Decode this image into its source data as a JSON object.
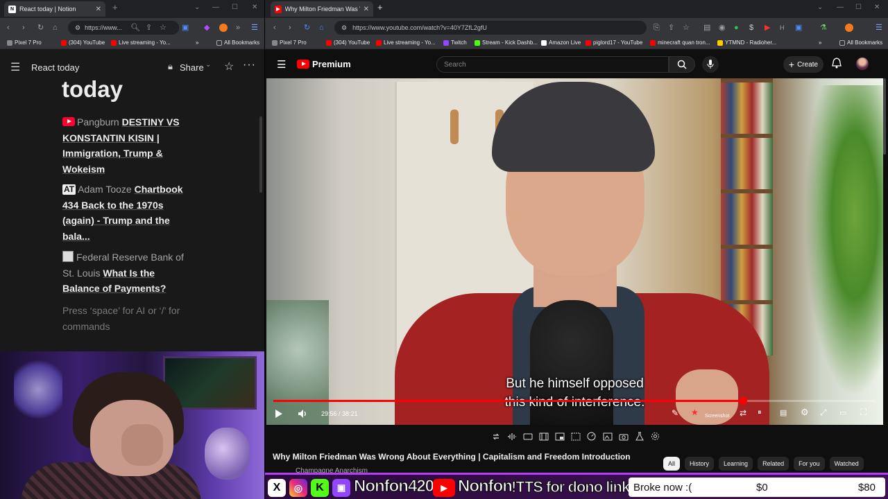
{
  "left_browser": {
    "tab_title": "React today | Notion",
    "url": "https://www...",
    "bookmarks": [
      "Pixel 7 Pro",
      "(304) YouTube",
      "Live streaming - Yo...",
      "All Bookmarks"
    ]
  },
  "notion": {
    "header_title": "React today",
    "share_label": "Share",
    "page_title": "today",
    "items": [
      {
        "source": "Pangburn",
        "link": "DESTINY VS KONSTANTIN KISIN | Immigration, Trump & Wokeism",
        "icon": "youtube-icon"
      },
      {
        "source": "Adam Tooze",
        "link": "Chartbook 434 Back to the 1970s (again) - Trump and the bala...",
        "icon": "at-icon"
      },
      {
        "source": "Federal Reserve Bank of St. Louis",
        "link": "What Is the Balance of Payments?",
        "icon": "image-icon"
      }
    ],
    "placeholder": "Press ‘space’ for AI or ‘/’ for commands"
  },
  "right_browser": {
    "tab_title": "Why Milton Friedman Was Wro",
    "url": "https://www.youtube.com/watch?v=40Y7ZfL2gfU",
    "bookmarks": [
      "Pixel 7 Pro",
      "(304) YouTube",
      "Live streaming - Yo...",
      "Twitch",
      "Stream - Kick Dashb...",
      "Amazon Live",
      "piglord17 - YouTube",
      "minecraft quan tron...",
      "YTMND - Radioher...",
      "All Bookmarks"
    ]
  },
  "youtube": {
    "logo_text": "Premium",
    "search_placeholder": "Search",
    "create_label": "Create",
    "subtitle_line1": "But he himself opposed",
    "subtitle_line2": "this kind of interference.",
    "time_display": "29:56 / 38:21",
    "progress": 0.78,
    "screenshot_label": "Screenshot",
    "video_title": "Why Milton Friedman Was Wrong About Everything | Capitalism and Freedom Introduction",
    "channel": "Champagne Anarchism",
    "chips": [
      "All",
      "History",
      "Learning",
      "Related",
      "For you",
      "Watched"
    ]
  },
  "stream_overlay": {
    "handle": "Nonfon420",
    "yt_name": "Nonfon",
    "tts_text": "!TTS for dono link",
    "goal_label": "Broke now :(",
    "goal_current": "$0",
    "goal_target": "$80",
    "accent": "#b43cff"
  }
}
